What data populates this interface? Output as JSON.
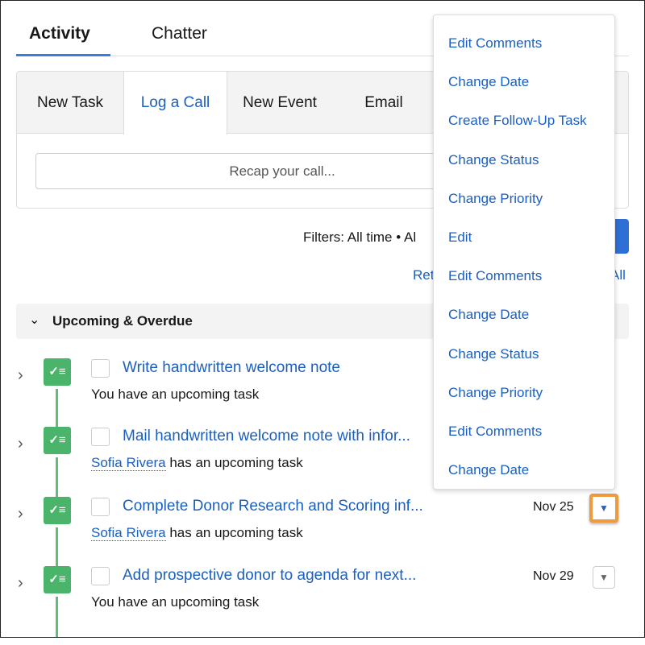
{
  "tabs": [
    {
      "label": "Activity",
      "selected": true
    },
    {
      "label": "Chatter",
      "selected": false
    }
  ],
  "composer": {
    "tabs": [
      "New Task",
      "Log a Call",
      "New Event",
      "Email"
    ],
    "active": "Log a Call",
    "placeholder": "Recap your call..."
  },
  "filters": {
    "text": "Filters: All time • Al",
    "links": [
      "Ret",
      "All"
    ]
  },
  "section": {
    "title": "Upcoming & Overdue"
  },
  "tasks": [
    {
      "title": "Write handwritten welcome note",
      "who": "",
      "sub": "You have an upcoming task",
      "date": ""
    },
    {
      "title": "Mail handwritten welcome note with infor...",
      "who": "Sofia Rivera",
      "sub": " has an upcoming task",
      "date": ""
    },
    {
      "title": "Complete Donor Research and Scoring inf...",
      "who": "Sofia Rivera",
      "sub": " has an upcoming task",
      "date": "Nov 25"
    },
    {
      "title": "Add prospective donor to agenda for next...",
      "who": "",
      "sub": "You have an upcoming task",
      "date": "Nov 29"
    }
  ],
  "menu": [
    "Edit Comments",
    "Change Date",
    "Create Follow-Up Task",
    "Change Status",
    "Change Priority",
    "Edit",
    "Edit Comments",
    "Change Date",
    "Change Status",
    "Change Priority",
    "Edit Comments",
    "Change Date"
  ],
  "colors": {
    "accent": "#1b5fc1",
    "task_icon": "#4bb46b",
    "focus": "#ef9a3c"
  }
}
